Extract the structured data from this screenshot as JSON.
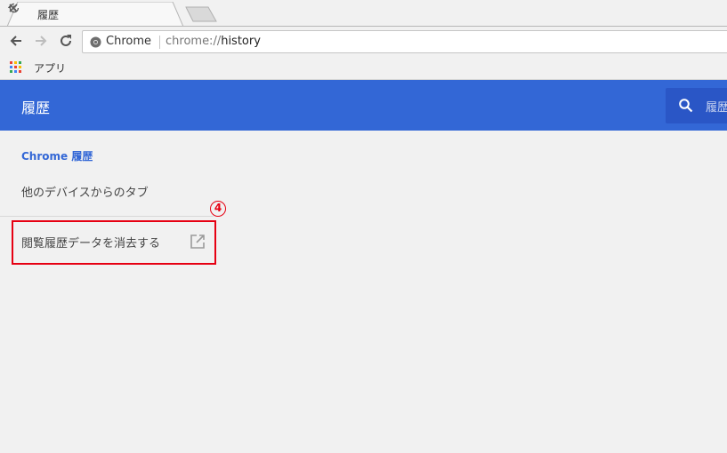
{
  "tab": {
    "title": "履歴"
  },
  "omnibox": {
    "chip": "Chrome",
    "url_scheme": "chrome://",
    "url_path": "history"
  },
  "bookmarks": {
    "apps_label": "アプリ"
  },
  "header": {
    "title": "履歴",
    "search_placeholder": "履歴"
  },
  "sidebar": {
    "items": [
      {
        "label": "Chrome 履歴"
      },
      {
        "label": "他のデバイスからのタブ"
      }
    ],
    "clear_label": "閲覧履歴データを消去する"
  },
  "annotation": {
    "number": "4"
  },
  "colors": {
    "brand": "#3367d6",
    "search_bg": "#2a56c6",
    "annotation": "#e60012"
  },
  "icons": [
    "history-icon",
    "close-icon",
    "back-icon",
    "forward-icon",
    "reload-icon",
    "chrome-icon",
    "apps-icon",
    "search-icon",
    "external-link-icon"
  ]
}
